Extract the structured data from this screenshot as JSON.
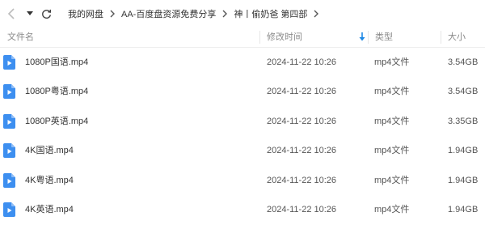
{
  "toolbar": {
    "back_icon": "chevron-left-icon",
    "dropdown_icon": "caret-down-icon",
    "refresh_icon": "refresh-icon",
    "breadcrumbs": [
      "我的网盘",
      "AA-百度盘资源免费分享",
      "神丨偷奶爸 第四部"
    ]
  },
  "columns": {
    "name": "文件名",
    "modified": "修改时间",
    "type": "类型",
    "size": "大小",
    "sort_icon": "sort-descending-arrow-icon"
  },
  "files": [
    {
      "name": "1080P国语.mp4",
      "modified": "2024-11-22 10:26",
      "type": "mp4文件",
      "size": "3.54GB",
      "icon": "video-file-icon"
    },
    {
      "name": "1080P粤语.mp4",
      "modified": "2024-11-22 10:26",
      "type": "mp4文件",
      "size": "3.54GB",
      "icon": "video-file-icon"
    },
    {
      "name": "1080P英语.mp4",
      "modified": "2024-11-22 10:26",
      "type": "mp4文件",
      "size": "3.35GB",
      "icon": "video-file-icon"
    },
    {
      "name": "4K国语.mp4",
      "modified": "2024-11-22 10:26",
      "type": "mp4文件",
      "size": "1.94GB",
      "icon": "video-file-icon"
    },
    {
      "name": "4K粤语.mp4",
      "modified": "2024-11-22 10:26",
      "type": "mp4文件",
      "size": "1.94GB",
      "icon": "video-file-icon"
    },
    {
      "name": "4K英语.mp4",
      "modified": "2024-11-22 10:26",
      "type": "mp4文件",
      "size": "1.94GB",
      "icon": "video-file-icon"
    }
  ],
  "colors": {
    "accent": "#1e88e5",
    "file_icon": "#3d8ff0",
    "header_text": "#8a8a8a"
  }
}
